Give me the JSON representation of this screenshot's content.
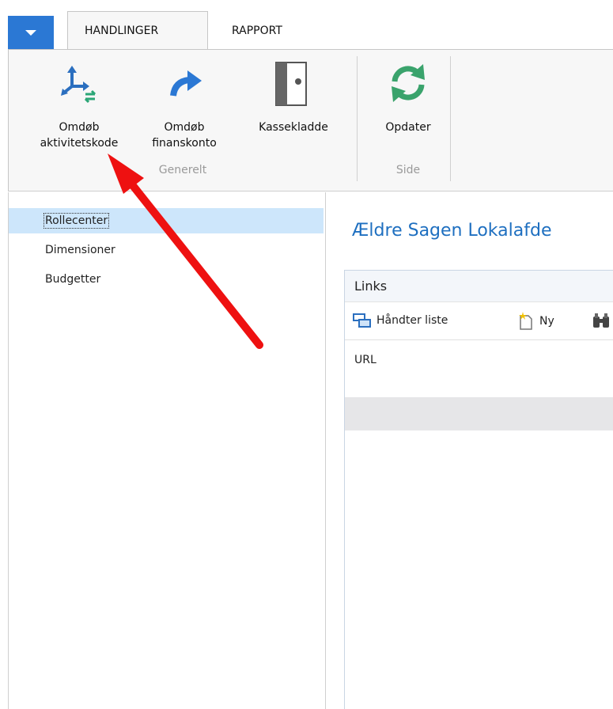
{
  "tabs": [
    {
      "label": "HANDLINGER",
      "active": true
    },
    {
      "label": "RAPPORT",
      "active": false
    }
  ],
  "ribbon": {
    "buttons": [
      {
        "line1": "Omdøb",
        "line2": "aktivitetskode",
        "icon": "rename-dimension-icon"
      },
      {
        "line1": "Omdøb",
        "line2": "finanskonto",
        "icon": "rename-arrow-icon"
      },
      {
        "line1": "Kassekladde",
        "icon": "journal-book-icon"
      },
      {
        "line1": "Opdater",
        "icon": "refresh-icon"
      }
    ],
    "groups": [
      "Generelt",
      "Side"
    ]
  },
  "nav": {
    "items": [
      "Rollecenter",
      "Dimensioner",
      "Budgetter"
    ],
    "selected": "Rollecenter"
  },
  "main": {
    "title": "Ældre Sagen Lokalafde",
    "links_part": {
      "title": "Links",
      "tools": [
        "Håndter liste",
        "Ny"
      ],
      "column": "URL"
    }
  },
  "colors": {
    "accent": "#2b78d4",
    "title_blue": "#1e6fc0",
    "annotation_arrow": "#ee1111",
    "selected_nav": "#cde6fb"
  }
}
